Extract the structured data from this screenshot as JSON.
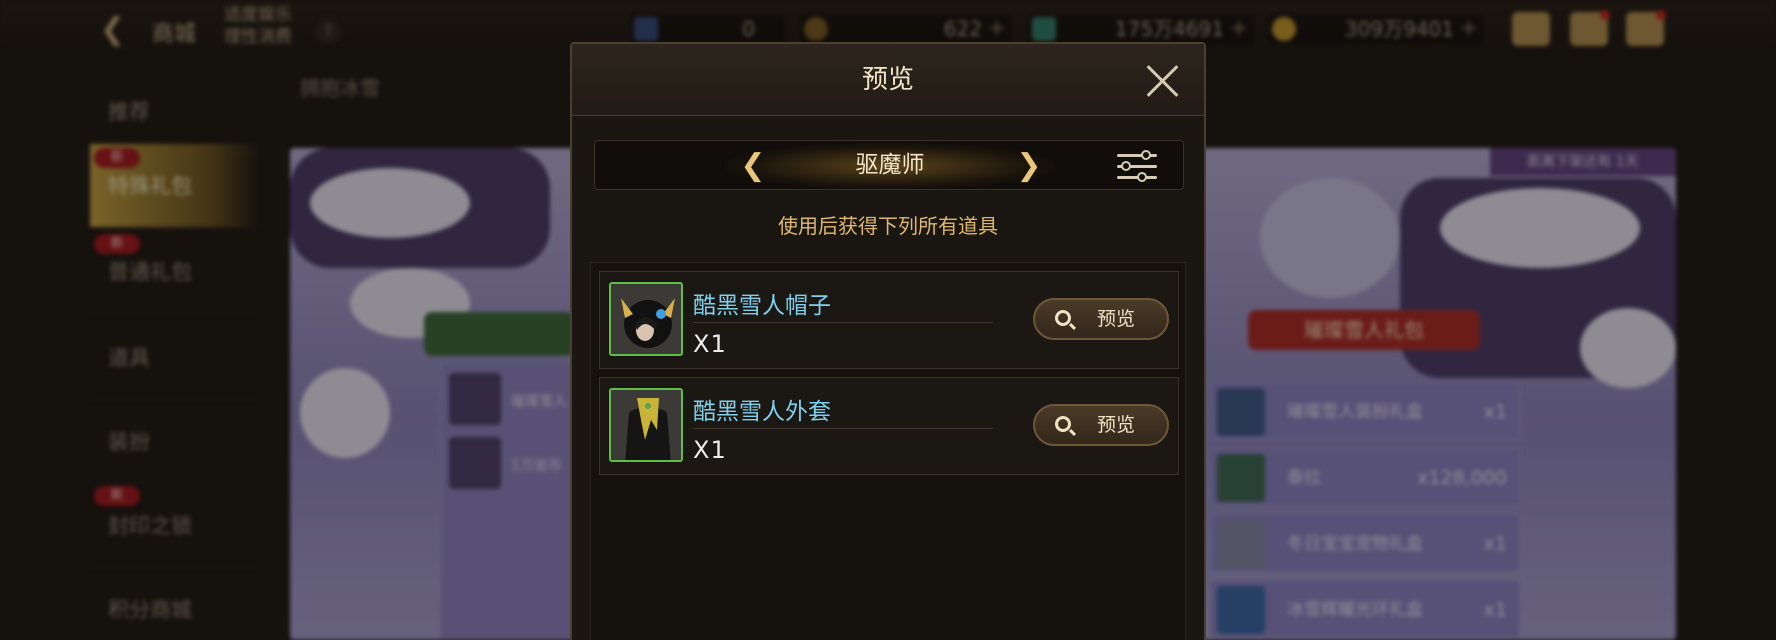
{
  "topbar": {
    "shop_title": "商城",
    "notice_line1": "适度娱乐",
    "notice_line2": "理性消费",
    "help_symbol": "?",
    "currencies": [
      {
        "value": "0",
        "icon": "ticket-icon",
        "has_plus": false
      },
      {
        "value": "622",
        "icon": "coin-c-icon",
        "has_plus": true
      },
      {
        "value": "175万4691",
        "icon": "green-crystal-icon",
        "has_plus": true
      },
      {
        "value": "309万9401",
        "icon": "gold-coin-icon",
        "has_plus": true
      }
    ],
    "plus_symbol": "+"
  },
  "sidebar": {
    "items": [
      {
        "label": "推荐",
        "new": false
      },
      {
        "label": "特殊礼包",
        "new": true,
        "active": true
      },
      {
        "label": "普通礼包",
        "new": true
      },
      {
        "label": "道具",
        "new": false
      },
      {
        "label": "装扮",
        "new": false
      },
      {
        "label": "封印之锁",
        "new": true
      },
      {
        "label": "积分商城",
        "new": false
      }
    ],
    "new_badge": "新"
  },
  "background": {
    "tab1": "拥抱冰雪",
    "timer": "距离下架还有 1天",
    "gift_title": "璀璨雪人礼包",
    "gift_rows": [
      {
        "name": "璀璨雪人装扮礼盒",
        "qty": "x1"
      },
      {
        "name": "泰拉",
        "qty": "x128,000"
      },
      {
        "name": "冬日宝宝宠物礼盒",
        "qty": "x1"
      },
      {
        "name": "冰雪辉耀光环礼盒",
        "qty": "x1"
      }
    ],
    "left_rows": [
      "璀璨雪人",
      "1万金币"
    ]
  },
  "modal": {
    "title": "预览",
    "class_name": "驱魔师",
    "hint": "使用后获得下列所有道具",
    "items": [
      {
        "name": "酷黑雪人帽子",
        "qty": "X1",
        "button": "预览"
      },
      {
        "name": "酷黑雪人外套",
        "qty": "X1",
        "button": "预览"
      }
    ]
  },
  "colors": {
    "item_name": "#7fd0ee",
    "hint": "#e0b871",
    "thumb_border": "#5fbf45"
  }
}
